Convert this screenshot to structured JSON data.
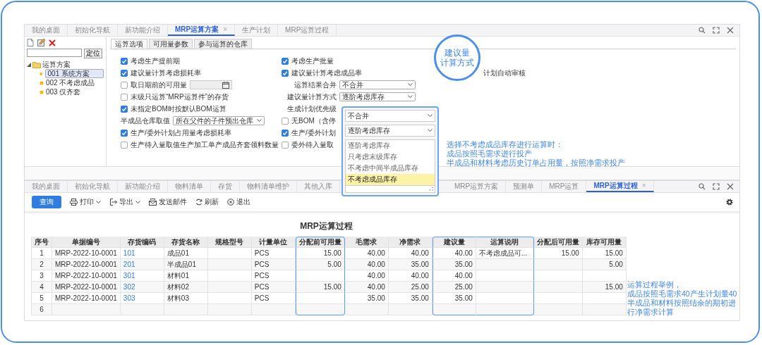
{
  "top_window": {
    "tabs": [
      {
        "label": "我的桌面",
        "selected": false
      },
      {
        "label": "初始化导航",
        "selected": false
      },
      {
        "label": "新功能介绍",
        "selected": false
      },
      {
        "label": "MRP运算方案",
        "selected": true,
        "close_mark": "×"
      },
      {
        "label": "生产计划",
        "selected": false
      },
      {
        "label": "MRP运算过程",
        "selected": false
      }
    ]
  },
  "scheme_panel": {
    "locate_button": "定位",
    "tree": [
      {
        "label": "运算方案",
        "expanded": true,
        "children": [
          {
            "label": "001 系统方案",
            "selected": true
          },
          {
            "label": "002 不考虑成品",
            "selected": false
          },
          {
            "label": "003 仅齐套",
            "selected": false
          }
        ]
      }
    ]
  },
  "option_tabs": [
    {
      "label": "运算选项",
      "selected": true
    },
    {
      "label": "可用量参数",
      "selected": false
    },
    {
      "label": "参与运算的仓库",
      "selected": false
    }
  ],
  "option_rows": [
    [
      {
        "kind": "checkbox",
        "label": "考虑生产提前期",
        "checked": true
      },
      {
        "kind": "checkbox",
        "label": "考虑生产批量",
        "checked": true
      }
    ],
    [
      {
        "kind": "checkbox",
        "label": "建议量计算考虑损耗率",
        "checked": true
      },
      {
        "kind": "checkbox",
        "label": "建议量计算考虑成品率",
        "checked": true
      },
      {
        "kind": "text",
        "label": "计划自动审核"
      }
    ],
    [
      {
        "kind": "date",
        "label": "取日期前的可用量",
        "checked": false
      },
      {
        "kind": "select",
        "label": "运算结果合并",
        "value": "不合并"
      }
    ],
    [
      {
        "kind": "checkbox",
        "label": "末级只运算“MRP运算件”的存货",
        "checked": false
      },
      {
        "kind": "select",
        "label": "建议量计算方式",
        "value": "逐阶考虑库存"
      }
    ],
    [
      {
        "kind": "checkbox",
        "label": "未指定BOM时按默认BOM运算",
        "checked": true
      },
      {
        "kind": "text_right",
        "label": "生成计划优先级"
      }
    ],
    [
      {
        "kind": "select",
        "label": "半成品仓库取值",
        "value": "所在父件的子件预出仓库"
      },
      {
        "kind": "checkbox",
        "label": "无BOM（含停",
        "checked": false
      }
    ],
    [
      {
        "kind": "checkbox",
        "label": "生产/委外计划占用量考虑损耗率",
        "checked": true
      },
      {
        "kind": "checkbox",
        "label": "生产/委外计划",
        "checked": true
      }
    ],
    [
      {
        "kind": "checkbox",
        "label": "生产待入量取值生产加工单产成品齐套领料数量",
        "checked": false
      },
      {
        "kind": "checkbox",
        "label": "委外待入量取",
        "checked": false
      }
    ]
  ],
  "callout": {
    "lines": [
      "建议量",
      "计算方式"
    ]
  },
  "popup": {
    "selects": [
      "不合并",
      "逐阶考虑库存"
    ],
    "options": [
      {
        "label": "逐阶考虑库存",
        "selected": false
      },
      {
        "label": "只考虑末级库存",
        "selected": false
      },
      {
        "label": "不考虑中间半成品库存",
        "selected": false
      },
      {
        "label": "不考虑成品库存",
        "selected": true
      }
    ]
  },
  "note_top": [
    "选择不考虑成品库存进行运算时：",
    "成品按照毛需求进行投产",
    "半成品和材料考虑历史订单占用量，按照净需求投产"
  ],
  "bottom_window": {
    "tabs_left": [
      {
        "label": "我的桌面",
        "selected": false
      },
      {
        "label": "初始化导航",
        "selected": false
      },
      {
        "label": "新功能介绍",
        "selected": false
      },
      {
        "label": "物料清单",
        "selected": false
      },
      {
        "label": "存货",
        "selected": false
      },
      {
        "label": "物料清单维护",
        "selected": false
      },
      {
        "label": "其他入库",
        "selected": false
      }
    ],
    "tabs_right": [
      {
        "label": "MRP运算方案",
        "selected": false
      },
      {
        "label": "预测单",
        "selected": false
      },
      {
        "label": "MRP运算",
        "selected": false
      },
      {
        "label": "MRP运算过程",
        "selected": true,
        "close_mark": "×"
      }
    ],
    "toolbar": [
      {
        "label": "查询",
        "kind": "primary"
      },
      {
        "label": "打印",
        "kind": "dropdown"
      },
      {
        "label": "导出",
        "kind": "dropdown"
      },
      {
        "label": "发送邮件",
        "kind": "plain"
      },
      {
        "label": "刷新",
        "kind": "plain"
      },
      {
        "label": "退出",
        "kind": "plain"
      }
    ]
  },
  "table": {
    "title": "MRP运算过程",
    "columns": [
      {
        "label": "序号",
        "kind": "index"
      },
      {
        "label": "单据编号",
        "kind": "text"
      },
      {
        "label": "存货编码",
        "kind": "link"
      },
      {
        "label": "存货名称",
        "kind": "text"
      },
      {
        "label": "规格型号",
        "kind": "text"
      },
      {
        "label": "计量单位",
        "kind": "text"
      },
      {
        "label": "分配前可用量",
        "kind": "number",
        "boxed": true
      },
      {
        "label": "毛需求",
        "kind": "number"
      },
      {
        "label": "净需求",
        "kind": "number"
      },
      {
        "label": "建议量",
        "kind": "number",
        "boxed": true
      },
      {
        "label": "运算说明",
        "kind": "text",
        "boxed": true
      },
      {
        "label": "分配后可用量",
        "kind": "number"
      },
      {
        "label": "库存可用量",
        "kind": "number"
      }
    ],
    "rows": [
      [
        "1",
        "MRP-2022-10-0001",
        "101",
        "成品01",
        null,
        "PCS",
        "15.00",
        "40.00",
        "40.00",
        "40.00",
        "不考虑成品可...",
        "15.00",
        "15.00"
      ],
      [
        "2",
        "MRP-2022-10-0001",
        "201",
        "半成品01",
        null,
        "PCS",
        "5.00",
        "40.00",
        "35.00",
        "35.00",
        null,
        null,
        "5.00"
      ],
      [
        "3",
        "MRP-2022-10-0001",
        "301",
        "材料01",
        null,
        "PCS",
        null,
        "40.00",
        "40.00",
        "40.00",
        null,
        null,
        null
      ],
      [
        "4",
        "MRP-2022-10-0001",
        "302",
        "材料02",
        null,
        "PCS",
        "15.00",
        "40.00",
        "25.00",
        "25.00",
        null,
        null,
        "15.00"
      ],
      [
        "5",
        "MRP-2022-10-0001",
        "303",
        "材料03",
        null,
        "PCS",
        null,
        "35.00",
        "35.00",
        "35.00",
        null,
        null,
        null
      ],
      [
        "6",
        null,
        null,
        null,
        null,
        null,
        null,
        null,
        null,
        null,
        null,
        null,
        null
      ]
    ]
  },
  "note_bottom": [
    "运算过程举例，",
    "成品按照毛需求40产生计划量40",
    "半成品和材料按照结余的期初进行净需求计算"
  ]
}
